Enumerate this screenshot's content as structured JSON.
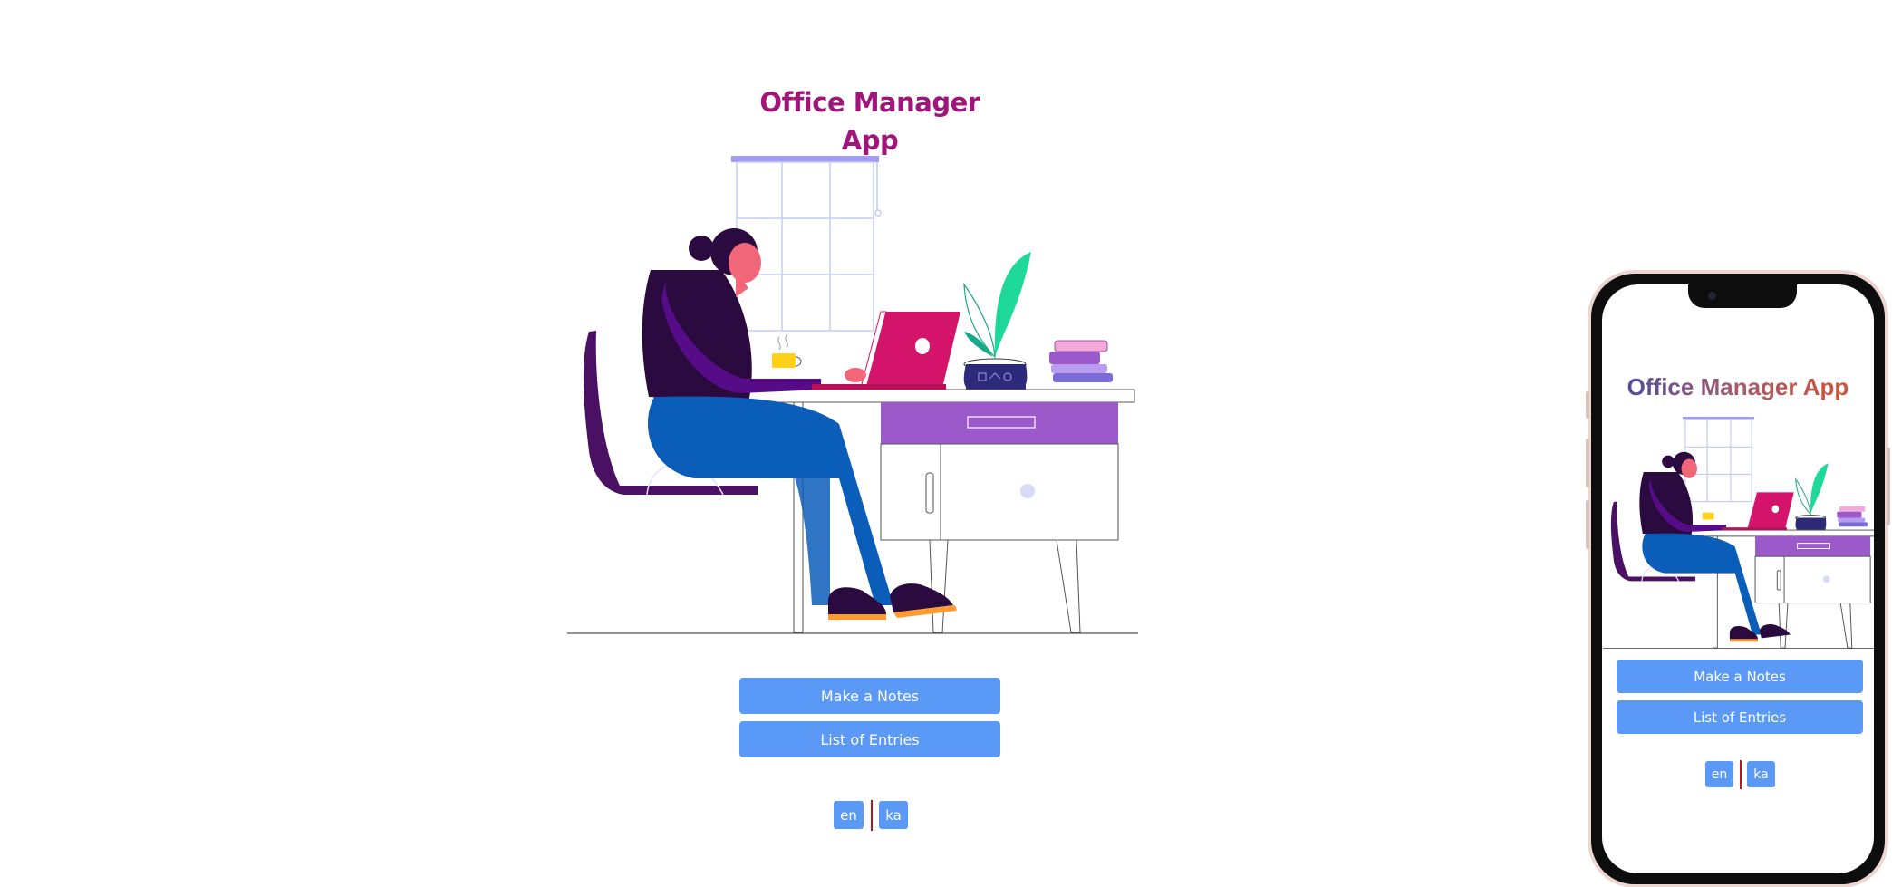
{
  "app": {
    "title": "Office Manager App",
    "title_color": "#a0157a",
    "title_gradient": [
      "#3f4aa6",
      "#a65a6a",
      "#d4542a"
    ]
  },
  "illustration": {
    "icon": "woman-working-at-desk-illustration",
    "colors": {
      "accent": "#9b59c9",
      "laptop": "#d4136b",
      "plant": "#1fd99a",
      "pants": "#0a5db8",
      "shirt": "#560c86",
      "skin": "#f2667a"
    }
  },
  "actions": {
    "make_notes": "Make a Notes",
    "list_entries": "List of Entries"
  },
  "language": {
    "en": "en",
    "ka": "ka"
  },
  "theme": {
    "button": "#5a99f5",
    "separator": "#b11a1a"
  }
}
